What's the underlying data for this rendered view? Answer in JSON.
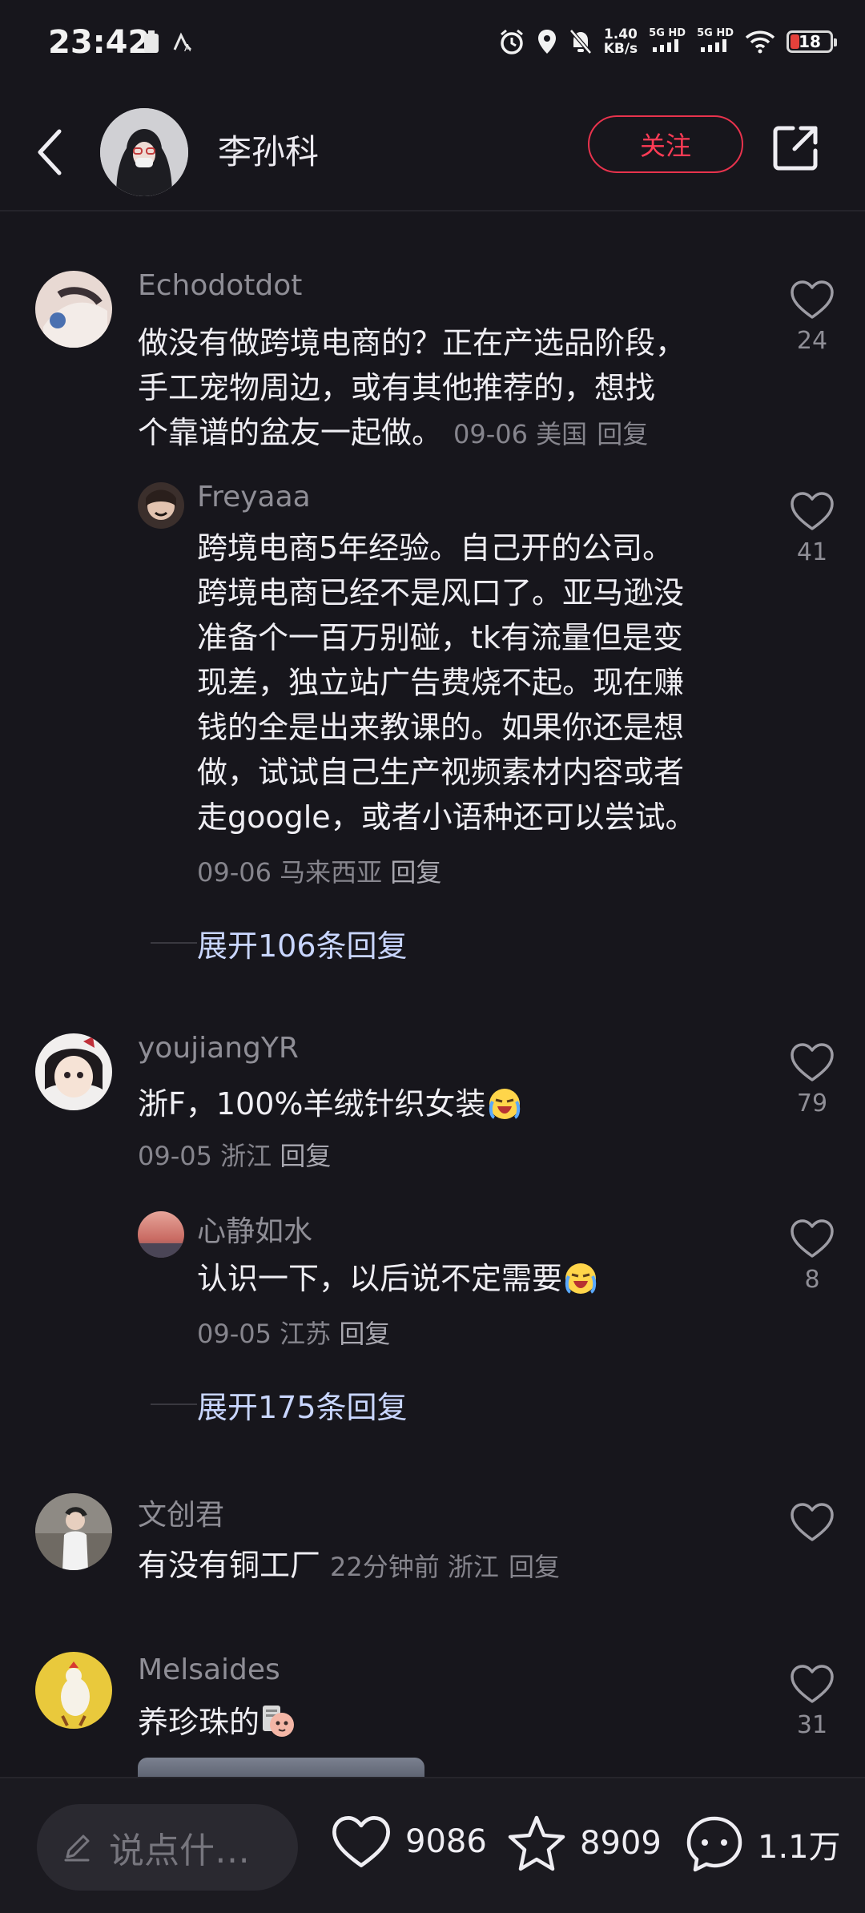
{
  "status_bar": {
    "time": "23:42",
    "speed_value": "1.40",
    "speed_unit": "KB/s",
    "sig1": "5G HD",
    "sig2": "5G HD",
    "battery": "18"
  },
  "header": {
    "username": "李孙科",
    "follow_label": "关注"
  },
  "comments": [
    {
      "user": "Echodotdot",
      "text_lines": [
        "做没有做跨境电商的？正在产选品阶段，",
        "手工宠物周边，或有其他推荐的，想找",
        "个靠谱的盆友一起做。"
      ],
      "meta": "09-06 美国",
      "reply": "回复",
      "likes": "24",
      "sub": {
        "user": "Freyaaa",
        "text_lines": [
          "跨境电商5年经验。自己开的公司。",
          "跨境电商已经不是风口了。亚马逊没",
          "准备个一百万别碰，tk有流量但是变",
          "现差，独立站广告费烧不起。现在赚",
          "钱的全是出来教课的。如果你还是想",
          "做，试试自己生产视频素材内容或者",
          "走google，或者小语种还可以尝试。"
        ],
        "meta": "09-06 马来西亚",
        "reply": "回复",
        "likes": "41"
      },
      "expand": "展开106条回复"
    },
    {
      "user": "youjiangYR",
      "text": "浙F，100%羊绒针织女装",
      "meta": "09-05 浙江",
      "reply": "回复",
      "likes": "79",
      "sub": {
        "user": "心静如水",
        "text": "认识一下，以后说不定需要",
        "meta": "09-05 江苏",
        "reply": "回复",
        "likes": "8"
      },
      "expand": "展开175条回复"
    },
    {
      "user": "文创君",
      "text": "有没有铜工厂",
      "meta": "22分钟前  浙江",
      "reply": "回复",
      "likes": ""
    },
    {
      "user": "Melsaides",
      "text": "养珍珠的",
      "likes": "31"
    }
  ],
  "bottom": {
    "input_placeholder": "说点什…",
    "likes": "9086",
    "favorites": "8909",
    "comments": "1.1万"
  },
  "colors": {
    "background": "#17161c",
    "accent_red": "#ff3b55",
    "expand_blue": "#c9d6ff"
  }
}
